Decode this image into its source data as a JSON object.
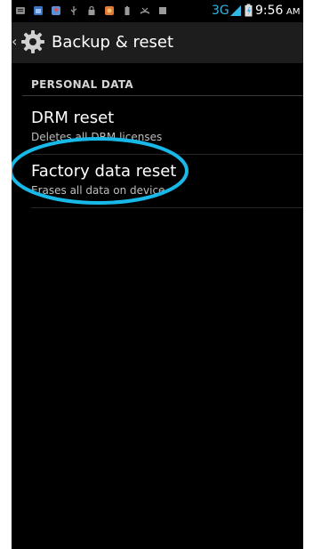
{
  "colors": {
    "background": "#000000",
    "action_bar": "#1d1d1d",
    "annotation": "#18b9e8",
    "signal_accent": "#33b5e5"
  },
  "status_bar": {
    "network": "3G",
    "time": "9:56",
    "am_pm": "AM",
    "icons": [
      "sms-icon",
      "calendar-icon",
      "contact-icon",
      "usb-icon",
      "lock-icon",
      "app-icon",
      "battery-small-icon",
      "missed-call-icon",
      "storage-icon",
      "signal-icon",
      "battery-icon"
    ]
  },
  "action_bar": {
    "title": "Backup & reset",
    "icon": "settings-gear-icon"
  },
  "section": {
    "header": "PERSONAL DATA"
  },
  "items": [
    {
      "title": "DRM reset",
      "subtitle": "Deletes all DRM licenses"
    },
    {
      "title": "Factory data reset",
      "subtitle": "Erases all data on device"
    }
  ]
}
